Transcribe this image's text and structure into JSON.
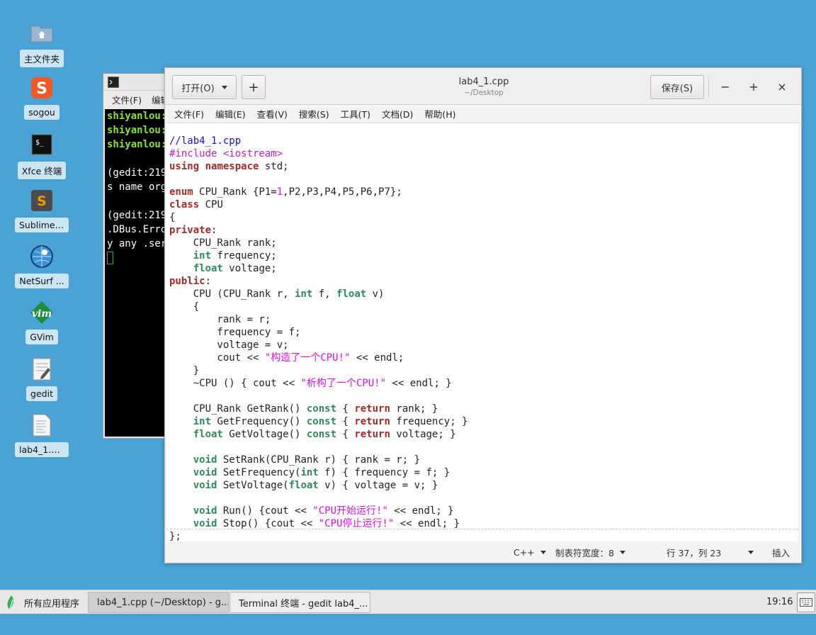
{
  "desktop": {
    "icons": [
      {
        "label": "主文件夹",
        "icon": "home-folder-icon"
      },
      {
        "label": "sogou",
        "icon": "sogou-icon"
      },
      {
        "label": "Xfce 终端",
        "icon": "terminal-icon"
      },
      {
        "label": "Sublime ...",
        "icon": "sublime-icon"
      },
      {
        "label": "NetSurf ...",
        "icon": "netsurf-icon"
      },
      {
        "label": "GVim",
        "icon": "gvim-icon"
      },
      {
        "label": "gedit",
        "icon": "gedit-icon"
      },
      {
        "label": "lab4_1.cpp",
        "icon": "cpp-file-icon"
      }
    ]
  },
  "terminal": {
    "menu": [
      "文件(F)",
      "编辑"
    ],
    "lines": [
      {
        "text": "shiyanlou:",
        "style": "prompt"
      },
      {
        "text": "shiyanlou:",
        "style": "prompt"
      },
      {
        "text": "shiyanlou:",
        "style": "prompt"
      },
      {
        "text": "",
        "style": "plain"
      },
      {
        "text": "(gedit:219",
        "style": "plain"
      },
      {
        "text": "s name org",
        "style": "plain"
      },
      {
        "text": "",
        "style": "plain"
      },
      {
        "text": "(gedit:219",
        "style": "plain"
      },
      {
        "text": ".DBus.Erro",
        "style": "plain"
      },
      {
        "text": "y any .serv",
        "style": "plain"
      }
    ]
  },
  "gedit": {
    "open_label": "打开(O)",
    "new_tab": "+",
    "title": "lab4_1.cpp",
    "subtitle": "~/Desktop",
    "save_label": "保存(S)",
    "minimize": "−",
    "maximize": "+",
    "close": "×",
    "menu": [
      "文件(F)",
      "编辑(E)",
      "查看(V)",
      "搜索(S)",
      "工具(T)",
      "文档(D)",
      "帮助(H)"
    ],
    "code_lines": [
      [
        [
          "cm",
          "//lab4_1.cpp"
        ]
      ],
      [
        [
          "pp",
          "#include <iostream>"
        ]
      ],
      [
        [
          "kw",
          "using"
        ],
        [
          "",
          " "
        ],
        [
          "kw",
          "namespace"
        ],
        [
          "",
          " std;"
        ]
      ],
      [],
      [
        [
          "kw",
          "enum"
        ],
        [
          "",
          " CPU_Rank {P1="
        ],
        [
          "nu",
          "1"
        ],
        [
          "",
          ",P2,P3,P4,P5,P6,P7};"
        ]
      ],
      [
        [
          "kw",
          "class"
        ],
        [
          "",
          " CPU"
        ]
      ],
      [
        [
          "",
          "{"
        ]
      ],
      [
        [
          "kw",
          "private"
        ],
        [
          "",
          ":"
        ]
      ],
      [
        [
          "",
          "    CPU_Rank rank;"
        ]
      ],
      [
        [
          "",
          "    "
        ],
        [
          "ty",
          "int"
        ],
        [
          "",
          " frequency;"
        ]
      ],
      [
        [
          "",
          "    "
        ],
        [
          "ty",
          "float"
        ],
        [
          "",
          " voltage;"
        ]
      ],
      [
        [
          "kw",
          "public"
        ],
        [
          "",
          ":"
        ]
      ],
      [
        [
          "",
          "    CPU (CPU_Rank r, "
        ],
        [
          "ty",
          "int"
        ],
        [
          "",
          " f, "
        ],
        [
          "ty",
          "float"
        ],
        [
          "",
          " v)"
        ]
      ],
      [
        [
          "",
          "    {"
        ]
      ],
      [
        [
          "",
          "        rank = r;"
        ]
      ],
      [
        [
          "",
          "        frequency = f;"
        ]
      ],
      [
        [
          "",
          "        voltage = v;"
        ]
      ],
      [
        [
          "",
          "        cout << "
        ],
        [
          "st",
          "\"构造了一个CPU!\""
        ],
        [
          "",
          " << endl;"
        ]
      ],
      [
        [
          "",
          "    }"
        ]
      ],
      [
        [
          "",
          "    ~CPU () { cout << "
        ],
        [
          "st",
          "\"析构了一个CPU!\""
        ],
        [
          "",
          " << endl; }"
        ]
      ],
      [],
      [
        [
          "",
          "    CPU_Rank GetRank() "
        ],
        [
          "ty",
          "const"
        ],
        [
          "",
          " { "
        ],
        [
          "kw",
          "return"
        ],
        [
          "",
          " rank; }"
        ]
      ],
      [
        [
          "",
          "    "
        ],
        [
          "ty",
          "int"
        ],
        [
          "",
          " GetFrequency() "
        ],
        [
          "ty",
          "const"
        ],
        [
          "",
          " { "
        ],
        [
          "kw",
          "return"
        ],
        [
          "",
          " frequency; }"
        ]
      ],
      [
        [
          "",
          "    "
        ],
        [
          "ty",
          "float"
        ],
        [
          "",
          " GetVoltage() "
        ],
        [
          "ty",
          "const"
        ],
        [
          "",
          " { "
        ],
        [
          "kw",
          "return"
        ],
        [
          "",
          " voltage; }"
        ]
      ],
      [],
      [
        [
          "",
          "    "
        ],
        [
          "ty",
          "void"
        ],
        [
          "",
          " SetRank(CPU_Rank r) { rank = r; }"
        ]
      ],
      [
        [
          "",
          "    "
        ],
        [
          "ty",
          "void"
        ],
        [
          "",
          " SetFrequency("
        ],
        [
          "ty",
          "int"
        ],
        [
          "",
          " f) { frequency = f; }"
        ]
      ],
      [
        [
          "",
          "    "
        ],
        [
          "ty",
          "void"
        ],
        [
          "",
          " SetVoltage("
        ],
        [
          "ty",
          "float"
        ],
        [
          "",
          " v) { voltage = v; }"
        ]
      ],
      [],
      [
        [
          "",
          "    "
        ],
        [
          "ty",
          "void"
        ],
        [
          "",
          " Run() {cout << "
        ],
        [
          "st",
          "\"CPU开始运行!\""
        ],
        [
          "",
          " << endl; }"
        ]
      ],
      [
        [
          "",
          "    "
        ],
        [
          "ty",
          "void"
        ],
        [
          "",
          " Stop() {cout << "
        ],
        [
          "st",
          "\"CPU停止运行!\""
        ],
        [
          "",
          " << endl; }"
        ]
      ],
      [
        [
          "",
          "};"
        ]
      ]
    ],
    "status": {
      "language": "C++",
      "tab_width": "制表符宽度：8",
      "position": "行 37，列 23",
      "mode": "插入"
    }
  },
  "taskbar": {
    "apps_label": "所有应用程序",
    "tasks": [
      {
        "label": "lab4_1.cpp (~/Desktop) - g...",
        "state": "active"
      },
      {
        "label": "Terminal 终端 - gedit lab4_...",
        "state": "inactive"
      }
    ],
    "clock": "19:16"
  }
}
